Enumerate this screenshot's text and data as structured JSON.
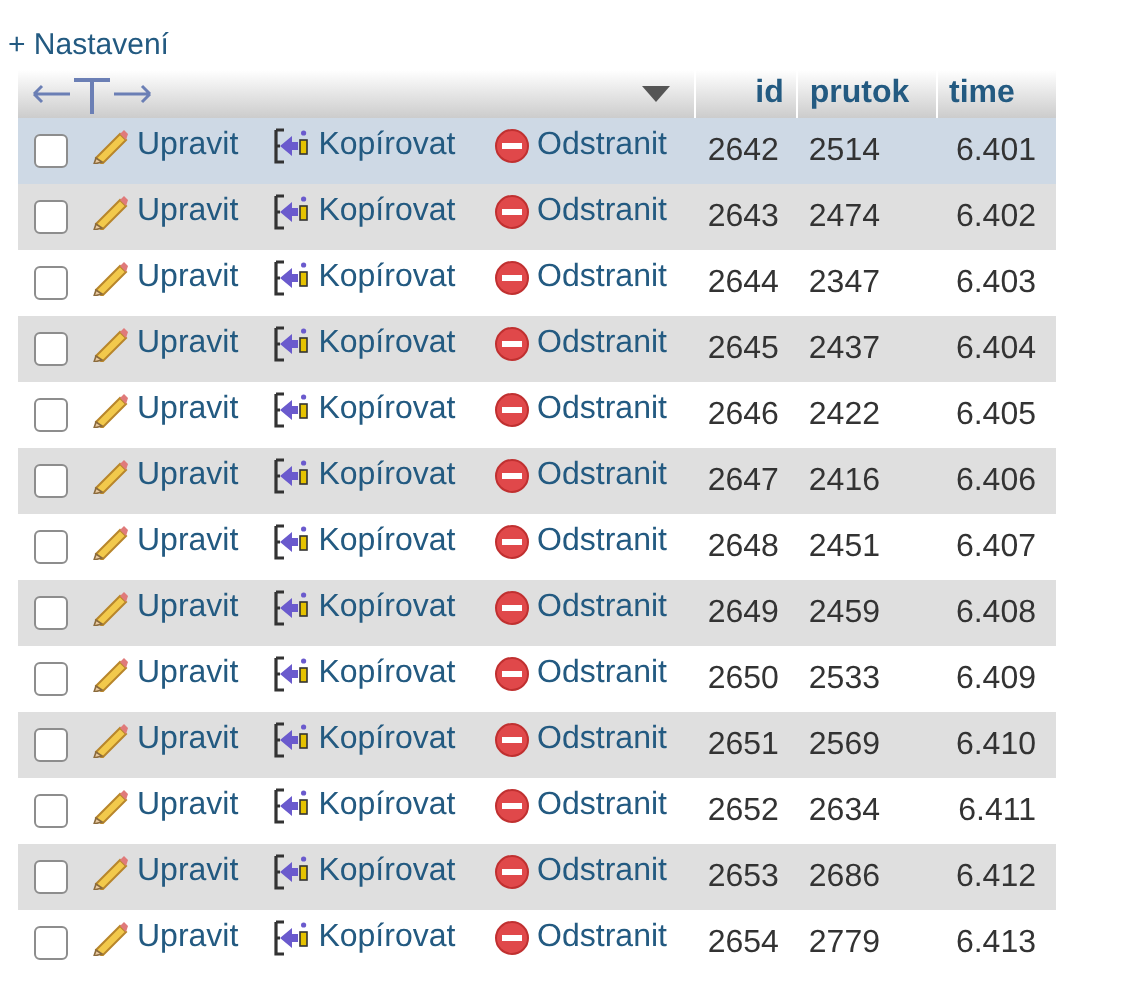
{
  "settings_link": "+ Nastavení",
  "columns": [
    {
      "label": "id"
    },
    {
      "label": "prutok"
    },
    {
      "label": "time"
    }
  ],
  "rows": [
    {
      "selected": true,
      "checked": false,
      "actions": [
        "Upravit",
        "Kopírovat",
        "Odstranit"
      ],
      "cells": [
        "2642",
        "2514",
        "6.401"
      ]
    },
    {
      "selected": false,
      "checked": false,
      "actions": [
        "Upravit",
        "Kopírovat",
        "Odstranit"
      ],
      "cells": [
        "2643",
        "2474",
        "6.402"
      ]
    },
    {
      "selected": false,
      "checked": false,
      "actions": [
        "Upravit",
        "Kopírovat",
        "Odstranit"
      ],
      "cells": [
        "2644",
        "2347",
        "6.403"
      ]
    },
    {
      "selected": false,
      "checked": false,
      "actions": [
        "Upravit",
        "Kopírovat",
        "Odstranit"
      ],
      "cells": [
        "2645",
        "2437",
        "6.404"
      ]
    },
    {
      "selected": false,
      "checked": false,
      "actions": [
        "Upravit",
        "Kopírovat",
        "Odstranit"
      ],
      "cells": [
        "2646",
        "2422",
        "6.405"
      ]
    },
    {
      "selected": false,
      "checked": false,
      "actions": [
        "Upravit",
        "Kopírovat",
        "Odstranit"
      ],
      "cells": [
        "2647",
        "2416",
        "6.406"
      ]
    },
    {
      "selected": false,
      "checked": false,
      "actions": [
        "Upravit",
        "Kopírovat",
        "Odstranit"
      ],
      "cells": [
        "2648",
        "2451",
        "6.407"
      ]
    },
    {
      "selected": false,
      "checked": false,
      "actions": [
        "Upravit",
        "Kopírovat",
        "Odstranit"
      ],
      "cells": [
        "2649",
        "2459",
        "6.408"
      ]
    },
    {
      "selected": false,
      "checked": false,
      "actions": [
        "Upravit",
        "Kopírovat",
        "Odstranit"
      ],
      "cells": [
        "2650",
        "2533",
        "6.409"
      ]
    },
    {
      "selected": false,
      "checked": false,
      "actions": [
        "Upravit",
        "Kopírovat",
        "Odstranit"
      ],
      "cells": [
        "2651",
        "2569",
        "6.410"
      ]
    },
    {
      "selected": false,
      "checked": false,
      "actions": [
        "Upravit",
        "Kopírovat",
        "Odstranit"
      ],
      "cells": [
        "2652",
        "2634",
        "6.411"
      ]
    },
    {
      "selected": false,
      "checked": false,
      "actions": [
        "Upravit",
        "Kopírovat",
        "Odstranit"
      ],
      "cells": [
        "2653",
        "2686",
        "6.412"
      ]
    },
    {
      "selected": false,
      "checked": false,
      "actions": [
        "Upravit",
        "Kopírovat",
        "Odstranit"
      ],
      "cells": [
        "2654",
        "2779",
        "6.413"
      ]
    }
  ]
}
